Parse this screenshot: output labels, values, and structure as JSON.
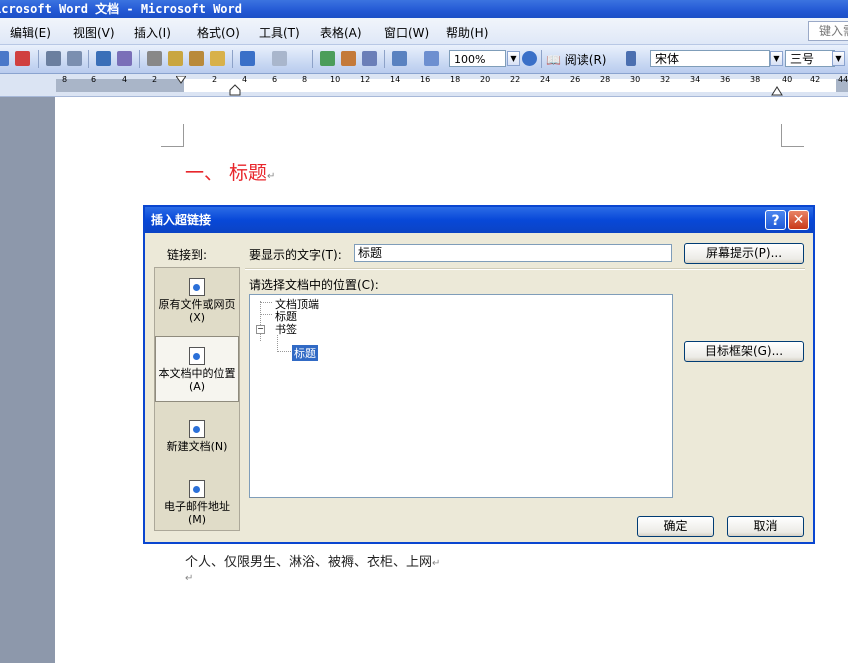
{
  "window": {
    "title": "icrosoft Word 文档 - Microsoft Word"
  },
  "menu": {
    "items": [
      "编辑(E)",
      "视图(V)",
      "插入(I)",
      "格式(O)",
      "工具(T)",
      "表格(A)",
      "窗口(W)",
      "帮助(H)"
    ],
    "help_placeholder": "键入需"
  },
  "toolbar": {
    "zoom": "100%",
    "reading_label": "阅读(R)",
    "font_name": "宋体",
    "font_size": "三号"
  },
  "ruler": {
    "ticks": [
      "8",
      "6",
      "4",
      "2",
      "2",
      "4",
      "6",
      "8",
      "10",
      "12",
      "14",
      "16",
      "18",
      "20",
      "22",
      "24",
      "26",
      "28",
      "30",
      "32",
      "34",
      "36",
      "38",
      "40",
      "42",
      "44"
    ]
  },
  "document": {
    "heading": "一、 标题",
    "body_text": "个人、仅限男生、淋浴、被褥、衣柜、上网",
    "para_mark": "↵"
  },
  "dialog": {
    "title": "插入超链接",
    "link_to_label": "链接到:",
    "link_to_items": [
      {
        "label": "原有文件或网页(X)",
        "selected": false
      },
      {
        "label": "本文档中的位置(A)",
        "selected": true
      },
      {
        "label": "新建文档(N)",
        "selected": false
      },
      {
        "label": "电子邮件地址(M)",
        "selected": false
      }
    ],
    "display_text_label": "要显示的文字(T):",
    "display_text_value": "标题",
    "screentip_button": "屏幕提示(P)...",
    "select_place_label": "请选择文档中的位置(C):",
    "tree": {
      "top_of_document": "文档顶端",
      "headings": "标题",
      "bookmarks": "书签",
      "bookmark_item": "标题"
    },
    "target_frame_button": "目标框架(G)...",
    "ok_button": "确定",
    "cancel_button": "取消"
  }
}
